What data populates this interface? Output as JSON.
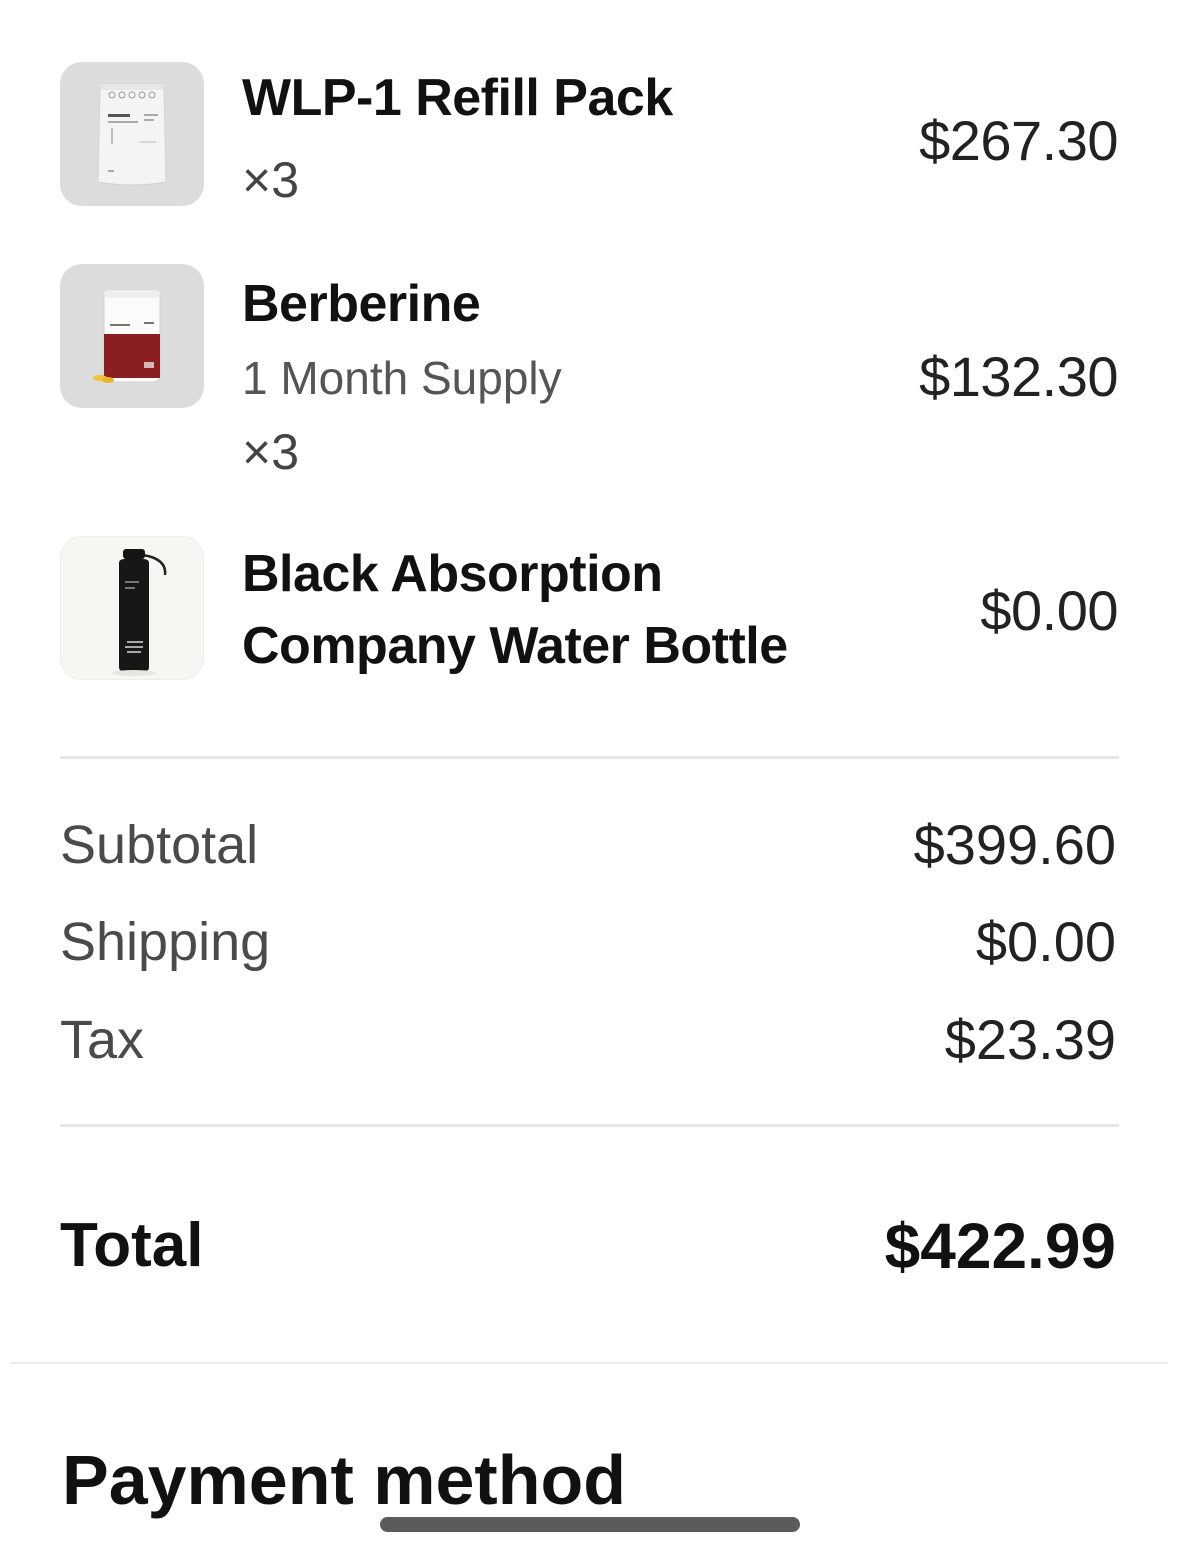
{
  "items": [
    {
      "title": "WLP-1 Refill Pack",
      "quantity": "×3",
      "price": "$267.30",
      "thumbnail": "refill-pack-pouch"
    },
    {
      "title": "Berberine",
      "variant": "1 Month Supply",
      "quantity": "×3",
      "price": "$132.30",
      "thumbnail": "berberine-bottle"
    },
    {
      "title_line1": "Black Absorption",
      "title_line2": "Company Water Bottle",
      "price": "$0.00",
      "thumbnail": "black-water-bottle"
    }
  ],
  "summary": {
    "subtotal_label": "Subtotal",
    "subtotal_value": "$399.60",
    "shipping_label": "Shipping",
    "shipping_value": "$0.00",
    "tax_label": "Tax",
    "tax_value": "$23.39"
  },
  "total": {
    "label": "Total",
    "value": "$422.99"
  },
  "payment": {
    "title": "Payment method"
  }
}
